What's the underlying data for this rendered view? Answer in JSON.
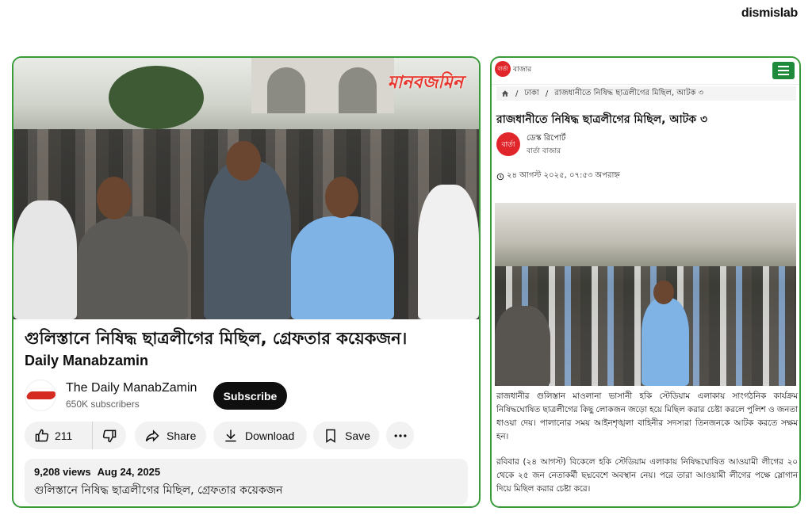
{
  "brand": "dismislab",
  "youtube": {
    "watermark": "মানবজমিন",
    "title": "গুলিস্তানে নিষিদ্ধ ছাত্রলীগের মিছিল, গ্রেফতার কয়েকজন।",
    "subtitle": "Daily Manabzamin",
    "channel_name": "The Daily ManabZamin",
    "subscribers": "650K subscribers",
    "subscribe_label": "Subscribe",
    "likes": "211",
    "share_label": "Share",
    "download_label": "Download",
    "save_label": "Save",
    "views": "9,208 views",
    "date": "Aug 24, 2025",
    "description": "গুলিস্তানে নিষিদ্ধ ছাত্রলীগের মিছিল, গ্রেফতার কয়েকজন"
  },
  "news": {
    "logo_text": "বার্তা",
    "site_name": "বাজার",
    "breadcrumb": [
      "ঢাকা",
      "রাজধানীতে নিষিদ্ধ ছাত্রলীগের মিছিল, আটক ৩"
    ],
    "title": "রাজধানীতে নিষিদ্ধ ছাত্রলীগের মিছিল, আটক ৩",
    "author_logo": "বার্তা",
    "author": "ডেস্ক রিপোর্ট",
    "publication": "বার্তা বাজার",
    "date": "২৪ আগস্ট ২০২৫, ০৭:৫৩ অপরাহ্ন",
    "paragraph1": "রাজধানীর গুলিস্তান মাওলানা ভাসানী হকি স্টেডিয়াম এলাকায় সাংগঠনিক কার্যক্রম নিষিদ্ধঘোষিত ছাত্রলীগের কিছু লোকজন জড়ো হয়ে মিছিল করার চেষ্টা করলে পুলিশ ও জনতা ধাওয়া দেয়। পালানোর সময় আইনশৃঙ্খলা বাহিনীর সদস্যরা তিনজনকে আটক করতে সক্ষম হন।",
    "paragraph2": "রবিবার (২৪ আগস্ট) বিকেলে হকি স্টেডিয়াম এলাকায় নিষিদ্ধঘোষিত আওয়ামী লীগের ২০ থেকে ২৫ জন নেতাকর্মী ছদ্মবেশে অবস্থান নেয়। পরে তারা আওয়ামী লীগের পক্ষে স্লোগান দিয়ে মিছিল করার চেষ্টা করে।"
  },
  "colors": {
    "frame": "#3a9a3a",
    "menu": "#1f8a3b",
    "logo_red": "#e0262b"
  }
}
